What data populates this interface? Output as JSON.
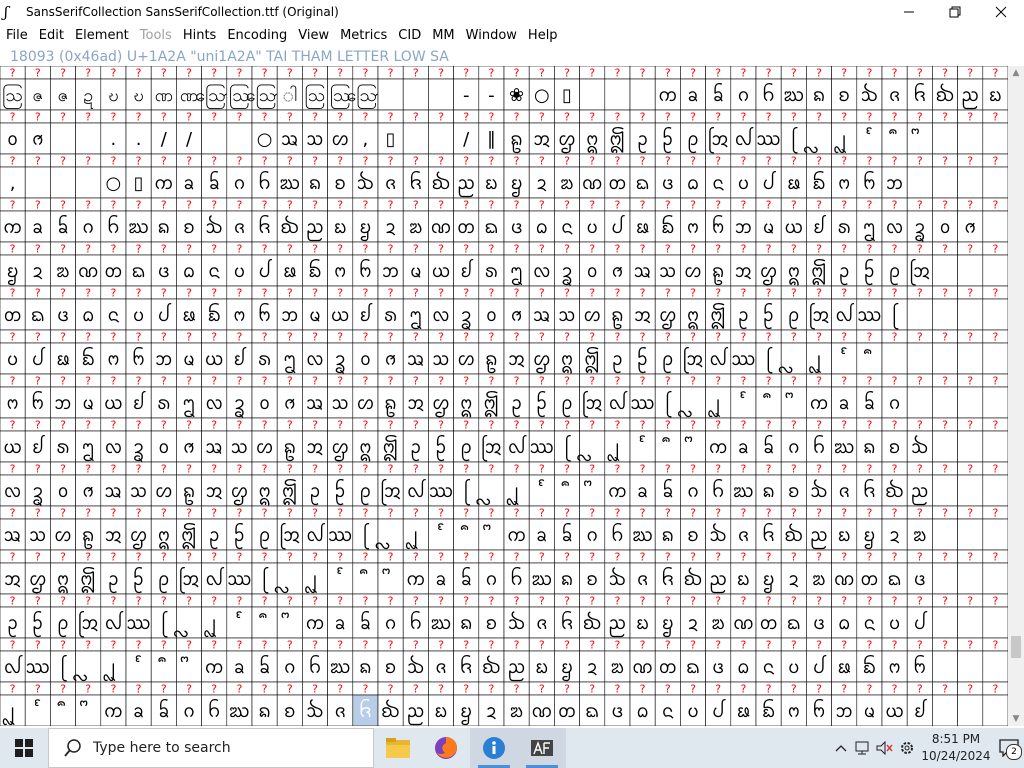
{
  "window": {
    "title": "SansSerifCollection  SansSerifCollection.ttf (Original)",
    "controls": {
      "minimize": "—",
      "maximize": "❐",
      "close": "✕"
    }
  },
  "menu": {
    "items": [
      {
        "label": "File",
        "enabled": true
      },
      {
        "label": "Edit",
        "enabled": true
      },
      {
        "label": "Element",
        "enabled": true
      },
      {
        "label": "Tools",
        "enabled": false
      },
      {
        "label": "Hints",
        "enabled": true
      },
      {
        "label": "Encoding",
        "enabled": true
      },
      {
        "label": "View",
        "enabled": true
      },
      {
        "label": "Metrics",
        "enabled": true
      },
      {
        "label": "CID",
        "enabled": true
      },
      {
        "label": "MM",
        "enabled": true
      },
      {
        "label": "Window",
        "enabled": true
      },
      {
        "label": "Help",
        "enabled": true
      }
    ]
  },
  "glyph_info": {
    "text": "18093 (0x46ad) U+1A2A \"uni1A2A\" TAI THAM LETTER LOW SA"
  },
  "font_view": {
    "missing_glyph_marker": "?",
    "selected_glyph_marker": "?",
    "empty_slot_marker": "▯",
    "glyph_rows": [
      "ဩဇဇဍဎဎဏဏဪဩဪါဩဩဪ   --❀○▯   ᨠᨡᨢᨣᨤᨥᨦᨧᨨᨩᨪᨫᨬᨭ",
      "ᩅᩆ  ..//  ○ᩇᩈᩉ,▯  /∥ᩊᩋᩌᩍᩎᩏᩐᩑᩒᩓᩔᩕᩖᩗᩘᩙᩚ",
      ",   ○▯ᨠᨡᨢᨣᨤᨥᨦᨧᨨᨩᨪᨫᨬᨭᨮᨯᨰᨱᨲᨳᨴᨵᨶᨷᨸᨹᨺᨻᨼᨽ",
      "ᨠᨡᨢᨣᨤᨥᨦᨧᨨᨩᨪᨫᨬᨭᨮᨯᨰᨱᨲᨳᨴᨵᨶᨷᨸᨹᨺᨻᨼᨽᨾᨿᩀᩁᩂᩃᩄᩅᩆ",
      "ᨮᨯᨰᨱᨲᨳᨴᨵᨶᨷᨸᨹᨺᨻᨼᨽᨾᨿᩀᩁᩂᩃᩄᩅᩆᩇᩈᩉᩊᩋᩌᩍᩎᩏᩐᩑᩒ",
      "ᨲᨳᨴᨵᨶᨷᨸᨹᨺᨻᨼᨽᨾᨿᩀᩁᩂᩃᩄᩅᩆᩇᩈᩉᩊᩋᩌᩍᩎᩏᩐᩑᩒᩓᩔᩕ",
      "ᨷᨸᨹᨺᨻᨼᨽᨾᨿᩀᩁᩂᩃᩄᩅᩆᩇᩈᩉᩊᩋᩌᩍᩎᩏᩐᩑᩒᩓᩔᩕᩖᩗᩘᩙ",
      "ᨻᨼᨽᨾᨿᩀᩁᩂᩃᩄᩅᩆᩇᩈᩉᩊᩋᩌᩍᩎᩏᩐᩑᩒᩓᩔᩕᩖᩗᩘᩙᩚᨠᨡᨢᨣ",
      "ᨿᩀᩁᩂᩃᩄᩅᩆᩇᩈᩉᩊᩋᩌᩍᩎᩏᩐᩑᩒᩓᩔᩕᩖᩗᩘᩙᩚᨠᨡᨢᨣᨤᨥᨦᨧᨨ",
      "ᩃᩄᩅᩆᩇᩈᩉᩊᩋᩌᩍᩎᩏᩐᩑᩒᩓᩔᩕᩖᩗᩘᩙᩚᨠᨡᨢᨣᨤᨥᨦᨧᨨᨩᨪᨫᨬ",
      "ᩇᩈᩉᩊᩋᩌᩍᩎᩏᩐᩑᩒᩓᩔᩕᩖᩗᩘᩙᩚᨠᨡᨢᨣᨤᨥᨦᨧᨨᨩᨪᨫᨬᨭᨮᨯᨰ",
      "ᩋᩌᩍᩎᩏᩐᩑᩒᩓᩔᩕᩖᩗᩘᩙᩚᨠᨡᨢᨣᨤᨥᨦᨧᨨᨩᨪᨫᨬᨭᨮᨯᨰᨱᨲᨳᨴ",
      "ᩏᩐᩑᩒᩓᩔᩕᩖᩗᩘᩙᩚᨠᨡᨢᨣᨤᨥᨦᨧᨨᨩᨪᨫᨬᨭᨮᨯᨰᨱᨲᨳᨴᨵᨶᨷᨸ",
      "ᩓᩔᩕᩖᩗᩘᩙᩚᨠᨡᨢᨣᨤᨥᨦᨧᨨᨩᨪᨫᨬᨭᨮᨯᨰᨱᨲᨳᨴᨵᨶᨷᨸᨹᨺᨻᨼ",
      "ᩗᩘᩙᩚᨠᨡᨢᨣᨤᨥᨦᨧᨨᨩᨪᨫᨬᨭᨮᨯᨰᨱᨲᨳᨴᨵᨶᨷᨸᨹᨺᨻᨼᨽᨾᨿᩀ"
    ],
    "selected_cell": {
      "row": 14,
      "col": 14
    }
  },
  "taskbar": {
    "search_placeholder": "Type here to search",
    "time": "8:51 PM",
    "date": "10/24/2024",
    "notification_count": "2",
    "apps": [
      "file-explorer",
      "firefox",
      "info",
      "fontforge"
    ]
  },
  "colors": {
    "missing_glyph": "#ff0000",
    "header_bg": "#ffffff",
    "selected_bg": "#b8cee8",
    "grid_line": "#000000",
    "info_text": "#8aa5c8",
    "taskbar_bg": "#dfe7ef"
  }
}
